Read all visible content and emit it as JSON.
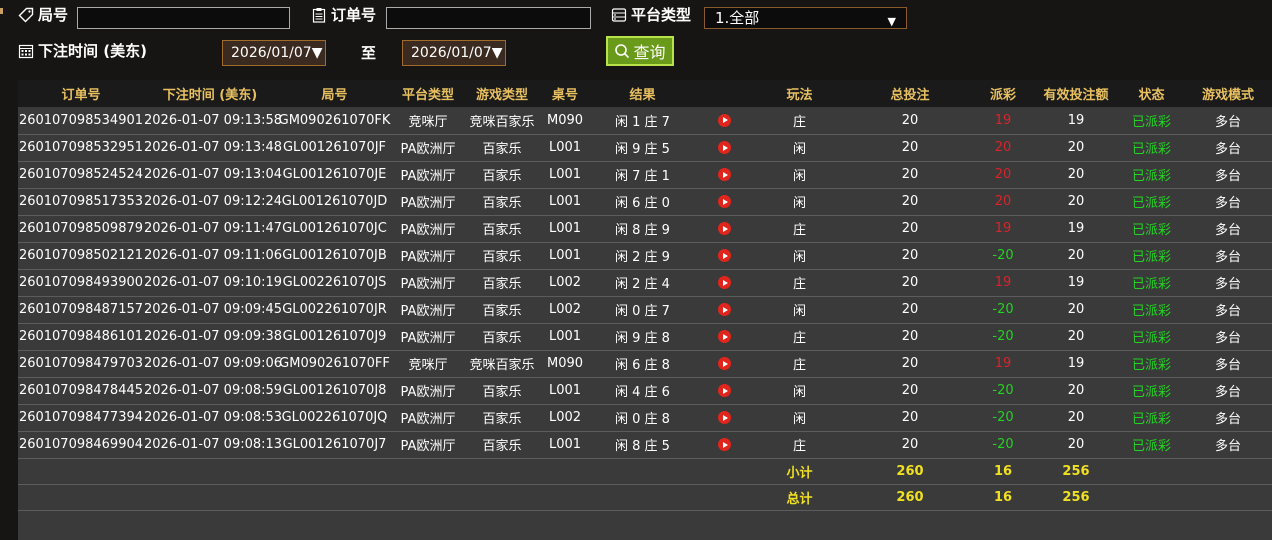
{
  "filters": {
    "round_label": "局号",
    "order_label": "订单号",
    "platform_label": "平台类型",
    "platform_value": "1.全部",
    "bet_time_label": "下注时间 (美东)",
    "date_from": "2026/01/07",
    "to_label": "至",
    "date_to": "2026/01/07",
    "query_label": "查询"
  },
  "table": {
    "headers": [
      "订单号",
      "下注时间 (美东)",
      "局号",
      "平台类型",
      "游戏类型",
      "桌号",
      "结果",
      "",
      "玩法",
      "总投注",
      "派彩",
      "有效投注额",
      "状态",
      "游戏模式"
    ],
    "rows": [
      {
        "order": "260107098534901",
        "time": "2026-01-07 09:13:58",
        "round": "GM090261070FK",
        "platform": "竞咪厅",
        "game": "竞咪百家乐",
        "table": "M090",
        "result": "闲 1 庄 7",
        "play": "庄",
        "bet": "20",
        "payout": "19",
        "valid": "19",
        "status": "已派彩",
        "mode": "多台"
      },
      {
        "order": "260107098532951",
        "time": "2026-01-07 09:13:48",
        "round": "GL001261070JF",
        "platform": "PA欧洲厅",
        "game": "百家乐",
        "table": "L001",
        "result": "闲 9 庄 5",
        "play": "闲",
        "bet": "20",
        "payout": "20",
        "valid": "20",
        "status": "已派彩",
        "mode": "多台"
      },
      {
        "order": "260107098524524",
        "time": "2026-01-07 09:13:04",
        "round": "GL001261070JE",
        "platform": "PA欧洲厅",
        "game": "百家乐",
        "table": "L001",
        "result": "闲 7 庄 1",
        "play": "闲",
        "bet": "20",
        "payout": "20",
        "valid": "20",
        "status": "已派彩",
        "mode": "多台"
      },
      {
        "order": "260107098517353",
        "time": "2026-01-07 09:12:24",
        "round": "GL001261070JD",
        "platform": "PA欧洲厅",
        "game": "百家乐",
        "table": "L001",
        "result": "闲 6 庄 0",
        "play": "闲",
        "bet": "20",
        "payout": "20",
        "valid": "20",
        "status": "已派彩",
        "mode": "多台"
      },
      {
        "order": "260107098509879",
        "time": "2026-01-07 09:11:47",
        "round": "GL001261070JC",
        "platform": "PA欧洲厅",
        "game": "百家乐",
        "table": "L001",
        "result": "闲 8 庄 9",
        "play": "庄",
        "bet": "20",
        "payout": "19",
        "valid": "19",
        "status": "已派彩",
        "mode": "多台"
      },
      {
        "order": "260107098502121",
        "time": "2026-01-07 09:11:06",
        "round": "GL001261070JB",
        "platform": "PA欧洲厅",
        "game": "百家乐",
        "table": "L001",
        "result": "闲 2 庄 9",
        "play": "闲",
        "bet": "20",
        "payout": "-20",
        "valid": "20",
        "status": "已派彩",
        "mode": "多台"
      },
      {
        "order": "260107098493900",
        "time": "2026-01-07 09:10:19",
        "round": "GL002261070JS",
        "platform": "PA欧洲厅",
        "game": "百家乐",
        "table": "L002",
        "result": "闲 2 庄 4",
        "play": "庄",
        "bet": "20",
        "payout": "19",
        "valid": "19",
        "status": "已派彩",
        "mode": "多台"
      },
      {
        "order": "260107098487157",
        "time": "2026-01-07 09:09:45",
        "round": "GL002261070JR",
        "platform": "PA欧洲厅",
        "game": "百家乐",
        "table": "L002",
        "result": "闲 0 庄 7",
        "play": "闲",
        "bet": "20",
        "payout": "-20",
        "valid": "20",
        "status": "已派彩",
        "mode": "多台"
      },
      {
        "order": "260107098486101",
        "time": "2026-01-07 09:09:38",
        "round": "GL001261070J9",
        "platform": "PA欧洲厅",
        "game": "百家乐",
        "table": "L001",
        "result": "闲 9 庄 8",
        "play": "庄",
        "bet": "20",
        "payout": "-20",
        "valid": "20",
        "status": "已派彩",
        "mode": "多台"
      },
      {
        "order": "260107098479703",
        "time": "2026-01-07 09:09:06",
        "round": "GM090261070FF",
        "platform": "竞咪厅",
        "game": "竞咪百家乐",
        "table": "M090",
        "result": "闲 6 庄 8",
        "play": "庄",
        "bet": "20",
        "payout": "19",
        "valid": "19",
        "status": "已派彩",
        "mode": "多台"
      },
      {
        "order": "260107098478445",
        "time": "2026-01-07 09:08:59",
        "round": "GL001261070J8",
        "platform": "PA欧洲厅",
        "game": "百家乐",
        "table": "L001",
        "result": "闲 4 庄 6",
        "play": "闲",
        "bet": "20",
        "payout": "-20",
        "valid": "20",
        "status": "已派彩",
        "mode": "多台"
      },
      {
        "order": "260107098477394",
        "time": "2026-01-07 09:08:53",
        "round": "GL002261070JQ",
        "platform": "PA欧洲厅",
        "game": "百家乐",
        "table": "L002",
        "result": "闲 0 庄 8",
        "play": "闲",
        "bet": "20",
        "payout": "-20",
        "valid": "20",
        "status": "已派彩",
        "mode": "多台"
      },
      {
        "order": "260107098469904",
        "time": "2026-01-07 09:08:13",
        "round": "GL001261070J7",
        "platform": "PA欧洲厅",
        "game": "百家乐",
        "table": "L001",
        "result": "闲 8 庄 5",
        "play": "庄",
        "bet": "20",
        "payout": "-20",
        "valid": "20",
        "status": "已派彩",
        "mode": "多台"
      }
    ],
    "subtotal": {
      "label": "小计",
      "bet": "260",
      "payout": "16",
      "valid": "256"
    },
    "total": {
      "label": "总计",
      "bet": "260",
      "payout": "16",
      "valid": "256"
    }
  },
  "colors": {
    "header_text": "#e8c060",
    "negative_payout": "#22d322",
    "positive_payout": "#d8242a",
    "status": "#22d322",
    "sum_text": "#f0e020",
    "query_button": "#6a9a1a"
  },
  "icons": {
    "round": "tag-icon",
    "order": "clipboard-icon",
    "platform": "list-icon",
    "date": "calendar-icon",
    "query": "search-icon",
    "replay": "play-icon"
  }
}
